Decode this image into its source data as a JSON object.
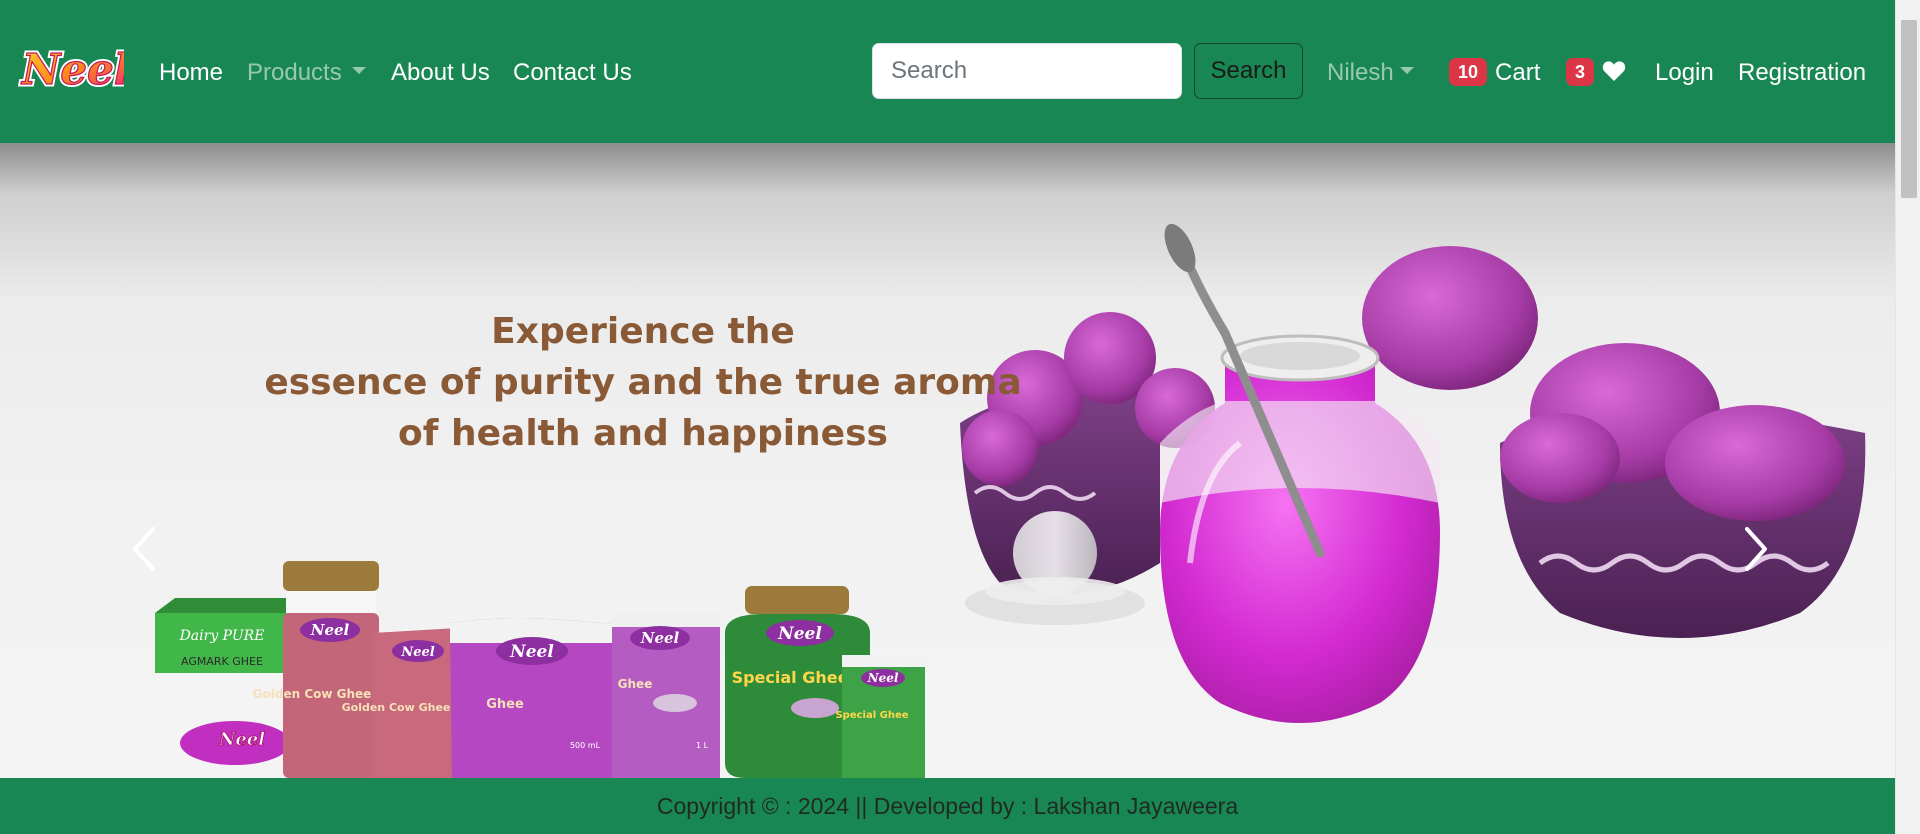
{
  "brand": {
    "logo_text": "Neel"
  },
  "nav": {
    "home": "Home",
    "products": "Products",
    "about": "About Us",
    "contact": "Contact Us"
  },
  "search": {
    "placeholder": "Search",
    "value": "",
    "button_label": "Search"
  },
  "user_menu": {
    "label": "Nilesh"
  },
  "cart": {
    "count": "10",
    "label": "Cart"
  },
  "wishlist": {
    "count": "3",
    "icon": "heart-icon"
  },
  "auth": {
    "login": "Login",
    "registration": "Registration"
  },
  "carousel": {
    "headline_lines": [
      "Experience the",
      "essence of purity and the true aroma",
      "of health and happiness"
    ],
    "products": {
      "box_brand": "Dairy PURE",
      "box_label": "AGMARK GHEE",
      "jar_label": "Golden Cow Ghee",
      "pouch_label": "Golden Cow Ghee",
      "pack_label": "Ghee",
      "pack_size": "500 mL",
      "carton_label": "Ghee",
      "carton_size": "1 L",
      "green_jar_label": "Special Ghee",
      "small_pouch_label": "Special Ghee",
      "brand_badge": "Neel"
    },
    "prev_icon": "chevron-left-icon",
    "next_icon": "chevron-right-icon"
  },
  "footer": {
    "text": "Copyright © : 2024 || Developed by : Lakshan Jayaweera"
  },
  "colors": {
    "navbar_bg": "#198754",
    "badge_bg": "#dc3545",
    "headline": "#8a5a36",
    "accent_purple": "#c21fc4"
  }
}
